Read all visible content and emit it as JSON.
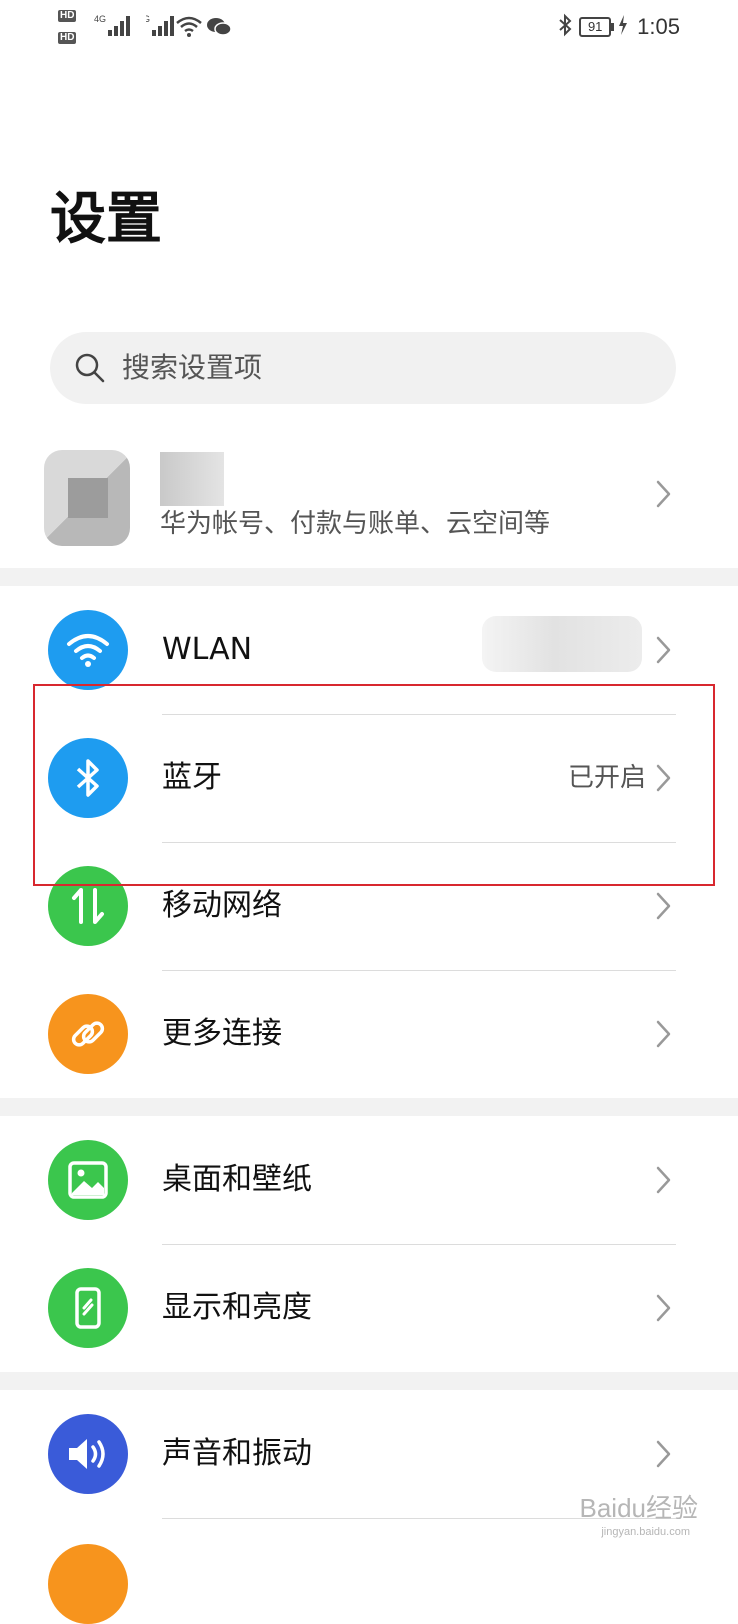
{
  "status_bar": {
    "hd1": "HD",
    "hd2": "HD",
    "net1": "4G",
    "net2": "4G",
    "battery": "91",
    "time": "1:05"
  },
  "page_title": "设置",
  "search": {
    "placeholder": "搜索设置项"
  },
  "account": {
    "subtitle": "华为帐号、付款与账单、云空间等"
  },
  "rows": [
    {
      "label": "WLAN",
      "value": "",
      "icon": "wifi-icon",
      "color": "#1e9cf0"
    },
    {
      "label": "蓝牙",
      "value": "已开启",
      "icon": "bluetooth-icon",
      "color": "#1e9cf0"
    },
    {
      "label": "移动网络",
      "value": "",
      "icon": "mobile-data-icon",
      "color": "#3bc64d"
    },
    {
      "label": "更多连接",
      "value": "",
      "icon": "link-icon",
      "color": "#f7941d"
    },
    {
      "label": "桌面和壁纸",
      "value": "",
      "icon": "wallpaper-icon",
      "color": "#3bc64d"
    },
    {
      "label": "显示和亮度",
      "value": "",
      "icon": "display-icon",
      "color": "#3bc64d"
    },
    {
      "label": "声音和振动",
      "value": "",
      "icon": "sound-icon",
      "color": "#3a5bd9"
    }
  ],
  "watermark": {
    "brand": "Baidu经验",
    "url": "jingyan.baidu.com"
  }
}
